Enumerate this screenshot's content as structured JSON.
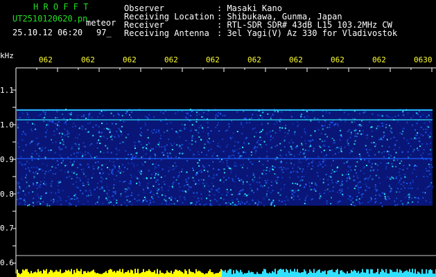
{
  "header": {
    "app_name": "H R O F F T",
    "filename": "UT2510120620.pn",
    "mode": "meteor",
    "datetime": "25.10.12 06:20",
    "count": "97_",
    "fields": [
      {
        "label": "Observer",
        "value": ": Masaki Kano"
      },
      {
        "label": "Receiving Location",
        "value": ": Shibukawa, Gunma, Japan"
      },
      {
        "label": "Receiver",
        "value": ": RTL-SDR SDR# 43dB L15 103.2MHz CW"
      },
      {
        "label": "Receiving Antenna",
        "value": ": 3el Yagi(V) Az 330 for Vladivostok"
      }
    ]
  },
  "axes": {
    "y_unit": "kHz",
    "y_ticks": [
      "1.1",
      "1.0",
      "0.9",
      "0.8",
      "0.7",
      "0.6"
    ],
    "x_ticks": [
      "062",
      "062",
      "062",
      "062",
      "062",
      "062",
      "062",
      "062",
      "062",
      "0630"
    ]
  },
  "colors": {
    "background": "#000000",
    "header_green": "#22e022",
    "axis_yellow": "#ffff33",
    "text_white": "#ffffff",
    "signal_low": "#0a1a8c",
    "signal_mid": "#2060ff",
    "signal_high": "#30ffff",
    "bottom_bar_yellow": "#ffff00",
    "bottom_bar_cyan": "#30e0ff"
  }
}
